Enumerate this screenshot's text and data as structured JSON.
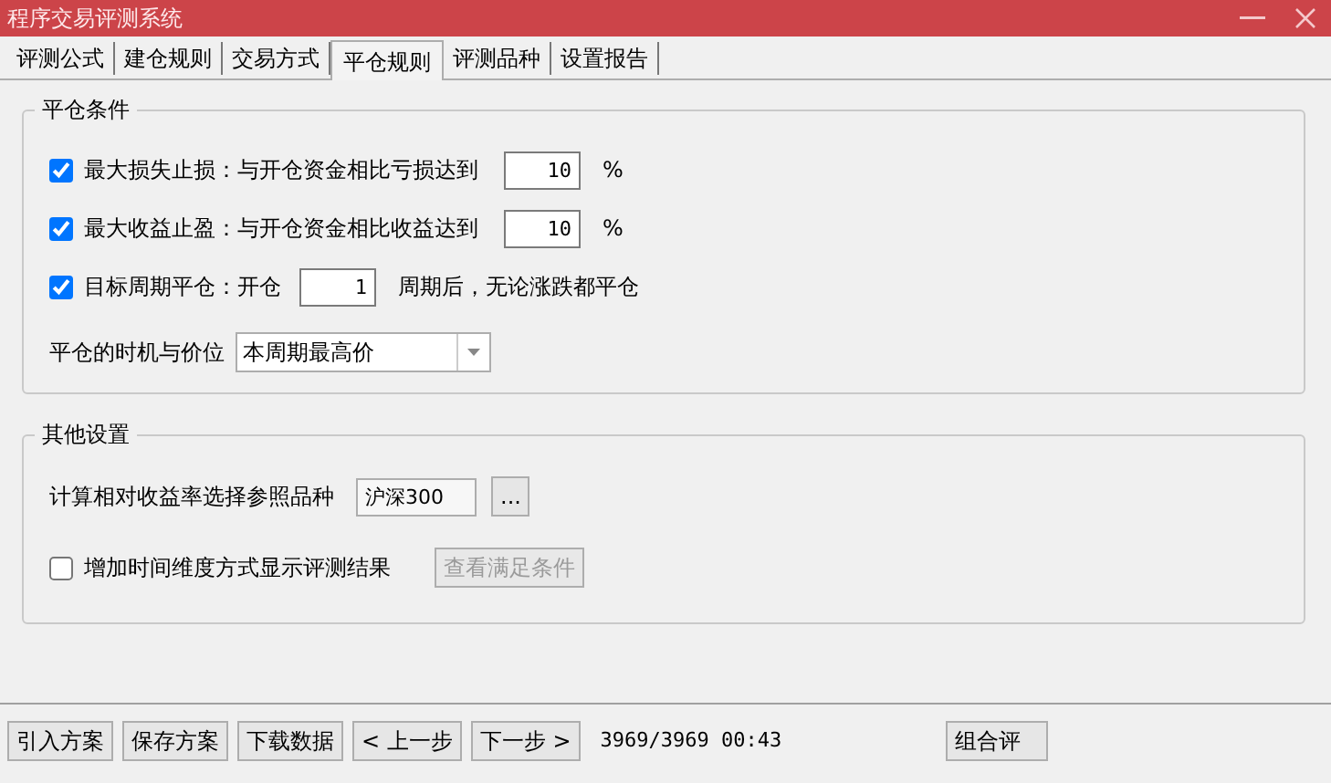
{
  "window": {
    "title": "程序交易评测系统"
  },
  "tabs": [
    {
      "label": "评测公式",
      "selected": false
    },
    {
      "label": "建仓规则",
      "selected": false
    },
    {
      "label": "交易方式",
      "selected": false
    },
    {
      "label": "平仓规则",
      "selected": true
    },
    {
      "label": "评测品种",
      "selected": false
    },
    {
      "label": "设置报告",
      "selected": false
    }
  ],
  "close_conditions": {
    "title": "平仓条件",
    "rows": [
      {
        "checked": true,
        "label": "最大损失止损：与开仓资金相比亏损达到",
        "value": "10",
        "unit": "%"
      },
      {
        "checked": true,
        "label": "最大收益止盈：与开仓资金相比收益达到",
        "value": "10",
        "unit": "%"
      },
      {
        "checked": true,
        "label": "目标周期平仓：开仓",
        "value": "1",
        "unit": "周期后，无论涨跌都平仓"
      }
    ],
    "timing": {
      "label": "平仓的时机与价位",
      "value": "本周期最高价"
    }
  },
  "other_settings": {
    "title": "其他设置",
    "reference": {
      "label": "计算相对收益率选择参照品种",
      "value": "沪深300",
      "button": "..."
    },
    "time_dimension": {
      "checked": false,
      "label": "增加时间维度方式显示评测结果",
      "button": "查看满足条件",
      "button_disabled": true
    }
  },
  "footer": {
    "buttons": [
      "引入方案",
      "保存方案",
      "下载数据",
      "< 上一步",
      "下一步 >"
    ],
    "status": "3969/3969 00:43",
    "cut_button": "组合评"
  }
}
